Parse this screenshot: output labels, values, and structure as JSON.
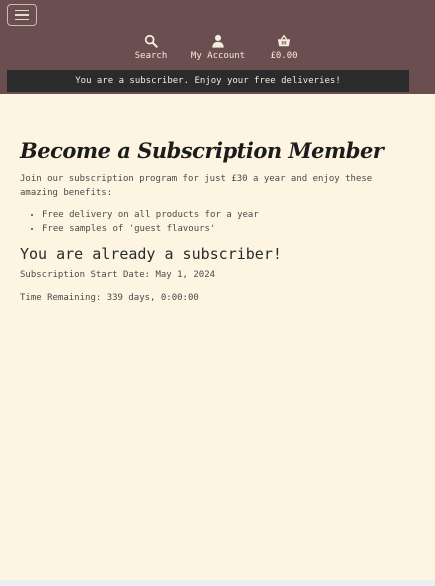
{
  "header": {
    "menu_icon": "hamburger-menu-icon",
    "nav": {
      "search_label": "Search",
      "account_label": "My Account",
      "basket_total": "£0.00"
    },
    "banner_text": "You are a subscriber. Enjoy your free deliveries!"
  },
  "main": {
    "title": "Become a Subscription Member",
    "intro": "Join our subscription program for just £30 a year and enjoy these amazing benefits:",
    "benefits": [
      "Free delivery on all products for a year",
      "Free samples of 'guest flavours'"
    ],
    "status_heading": "You are already a subscriber!",
    "start_date_text": "Subscription Start Date: May 1, 2024",
    "time_remaining_text": "Time Remaining: 339 days, 0:00:00"
  },
  "colors": {
    "header_bg": "#6b4e4f",
    "banner_bg": "#2b2b2b",
    "content_bg": "#fdf5e2",
    "nav_text": "#f4ecdd"
  }
}
